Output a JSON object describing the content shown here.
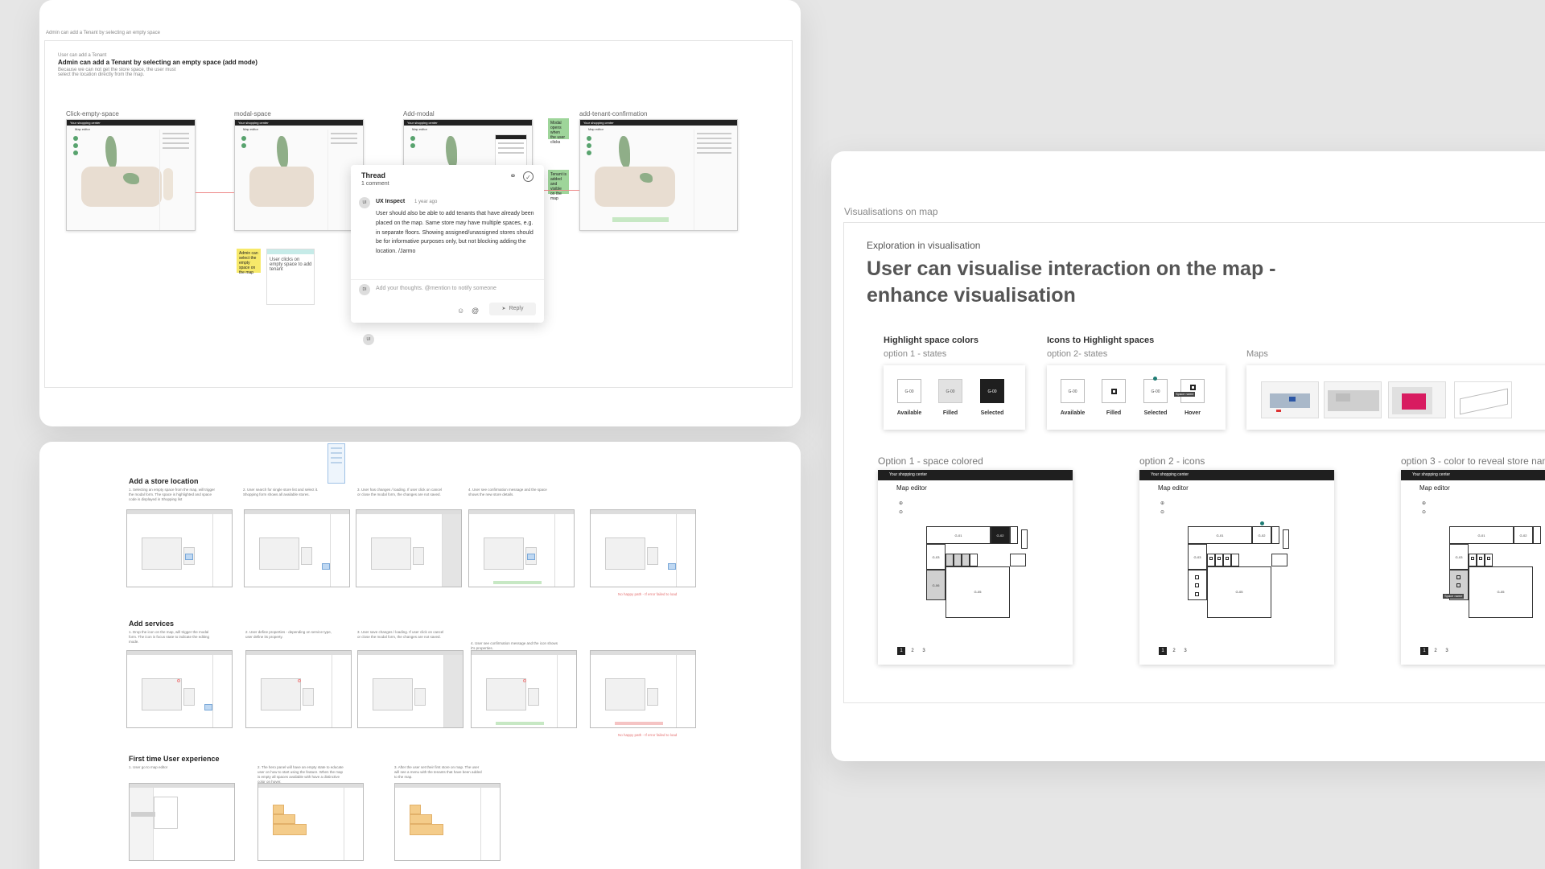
{
  "board_a": {
    "breadcrumb": "Admin can add a Tenant by selecting an empty space",
    "eyebrow": "User can add a Tenant",
    "heading": "Admin can add a Tenant by selecting an empty space (add mode)",
    "intro": "Because we can not get the store space, the user must select the location directly from the map.",
    "shots": [
      {
        "label": "Click-empty-space",
        "header": "Your shopping center",
        "subtitle": "Map editor"
      },
      {
        "label": "modal-space",
        "header": "Your shopping center",
        "subtitle": "Map editor"
      },
      {
        "label": "Add-modal",
        "header": "Your shopping center",
        "subtitle": "Map editor"
      },
      {
        "label": "add-tenant-confirmation",
        "header": "Your shopping center",
        "subtitle": "Map editor"
      }
    ],
    "sticky_note": "Admin can select the empty space on the map",
    "green_note_1": "Modal opens when the user clicks",
    "green_note_2": "Tenant is added and visible on the map",
    "card_text": "User clicks on empty space to add tenant",
    "bottom_avatar": "UI",
    "thread": {
      "title": "Thread",
      "count": "1 comment",
      "author_initials": "UI",
      "author": "UX Inspect",
      "time": "1 year ago",
      "body": "User should also be able to add tenants that have already been placed on the map. Same store may have multiple spaces, e.g. in separate floors. Showing assigned/unassigned stores should be for informative purposes only, but not blocking adding the location. /Jarmo",
      "me_initials": "DI",
      "placeholder": "Add your thoughts. @mention to notify someone",
      "emoji_icon": "☺",
      "at_icon": "@",
      "reply_label": "Reply",
      "link_icon": "⚭",
      "resolve_icon": "✓",
      "send_icon": "➤"
    }
  },
  "board_b": {
    "sections": [
      {
        "title": "Add a store location",
        "steps": [
          "1. Selecting an empty space from the map, will trigger the modal form. The space is highlighted and space code is displayed in Shopping list",
          "2. User search for single store list and select it. Shopping form shows all available stores.",
          "3. User has changes / loading. If user click on cancel or close the modal form, the changes are not saved.",
          "4. User see confirmation message and the space shows the new store details."
        ],
        "note": "No happy path - If error failed to load"
      },
      {
        "title": "Add services",
        "steps": [
          "1. Drop the icon on the map, will trigger the modal form. The icon is focus state to indicate the editing mode.",
          "2. User define properties - depending on service type, user define its property.",
          "3. User save changes / loading. If user click on cancel or close the modal form, the changes are not saved.",
          "4. User see confirmation message and the icon shows it's properties."
        ],
        "note": "No happy path - If error failed to load"
      },
      {
        "title": "First time User experience",
        "steps": [
          "1. User go to map editor",
          "2. The hero panel will have an empty state to educate user on how to start using the feature. When the map is empty all spaces available with have a distinctive color on hover.",
          "3. After the user set their first store on map. The user will see a menu with the tenants that have been added to the map."
        ],
        "note": ""
      }
    ]
  },
  "board_c": {
    "label": "Visualisations on map",
    "overline": "Exploration in visualisation",
    "title_line1": "User can visualise interaction on the map -",
    "title_line2": "enhance visualisation",
    "group1_title": "Highlight space colors",
    "group1_sub": "option 1 - states",
    "group2_title": "Icons to Highlight  spaces",
    "group2_sub": "option 2- states",
    "group3_sub": "Maps",
    "code": "G-00",
    "states1": [
      "Available",
      "Filled",
      "Selected"
    ],
    "states2": [
      "Available",
      "Filled",
      "Selected",
      "Hover"
    ],
    "hover_tag": "Space name",
    "options": [
      {
        "label": "Option 1 - space colored",
        "header": "Your shopping center",
        "subtitle": "Map editor",
        "pages": [
          "1",
          "2",
          "3"
        ]
      },
      {
        "label": "option 2 - icons",
        "header": "Your shopping center",
        "subtitle": "Map editor",
        "pages": [
          "1",
          "2",
          "3"
        ]
      },
      {
        "label": "option 3 - color to reveal store nam",
        "header": "Your shopping center",
        "subtitle": "Map editor",
        "pages": [
          "1",
          "2",
          "3"
        ]
      }
    ],
    "zoom_in": "⊕",
    "zoom_out": "⊖",
    "space_codes": [
      "G-01",
      "G-02",
      "G-03",
      "G-04",
      "G-05",
      "G-06",
      "G-07"
    ],
    "colors": {
      "dark": "#1f1f1f",
      "teal_pin": "#1e7c74",
      "pink": "#d81b60"
    }
  }
}
